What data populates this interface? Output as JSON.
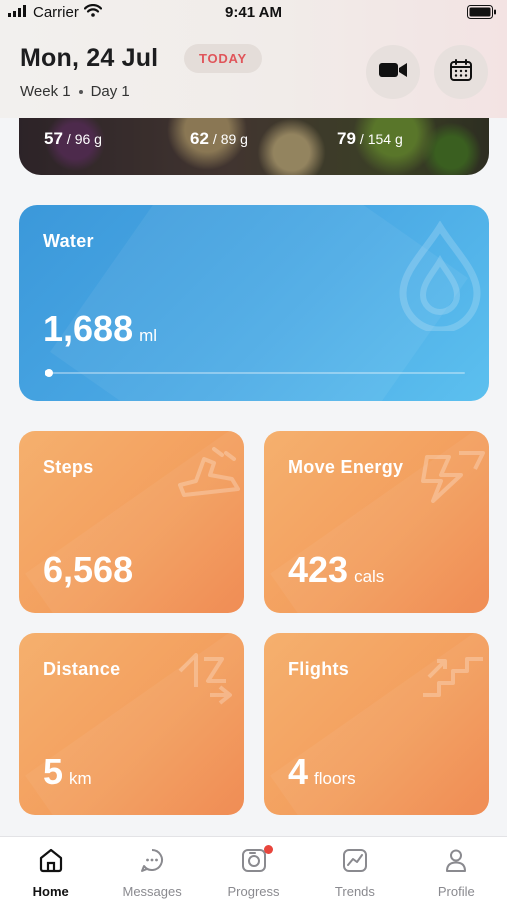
{
  "status_bar": {
    "carrier": "Carrier",
    "time": "9:41 AM",
    "icons": [
      "signal-icon",
      "wifi-icon",
      "battery-icon"
    ]
  },
  "header": {
    "date": "Mon, 24 Jul",
    "today_badge": "TODAY",
    "week": "Week 1",
    "day": "Day 1",
    "actions": [
      "video-icon",
      "calendar-icon"
    ]
  },
  "nutrition": {
    "macros": [
      {
        "value": "57",
        "target": "/ 96 g"
      },
      {
        "value": "62",
        "target": "/ 89 g"
      },
      {
        "value": "79",
        "target": "/ 154 g"
      }
    ]
  },
  "water": {
    "title": "Water",
    "value": "1,688",
    "unit": "ml",
    "progress": 0.01,
    "icon": "water-drop-icon",
    "color": "#4aa8e4"
  },
  "tiles": {
    "steps": {
      "title": "Steps",
      "value": "6,568",
      "unit": "",
      "icon": "shoe-icon"
    },
    "move": {
      "title": "Move Energy",
      "value": "423",
      "unit": "cals",
      "icon": "lightning-icon"
    },
    "distance": {
      "title": "Distance",
      "value": "5",
      "unit": "km",
      "icon": "distance-icon"
    },
    "flights": {
      "title": "Flights",
      "value": "4",
      "unit": "floors",
      "icon": "stairs-icon"
    },
    "color": "#f39f5e"
  },
  "nav": {
    "items": [
      {
        "label": "Home",
        "icon": "home-icon",
        "active": true
      },
      {
        "label": "Messages",
        "icon": "messages-icon",
        "active": false
      },
      {
        "label": "Progress",
        "icon": "progress-icon",
        "active": false,
        "badge": true
      },
      {
        "label": "Trends",
        "icon": "trends-icon",
        "active": false
      },
      {
        "label": "Profile",
        "icon": "profile-icon",
        "active": false
      }
    ],
    "badge_color": "#e8453c"
  }
}
